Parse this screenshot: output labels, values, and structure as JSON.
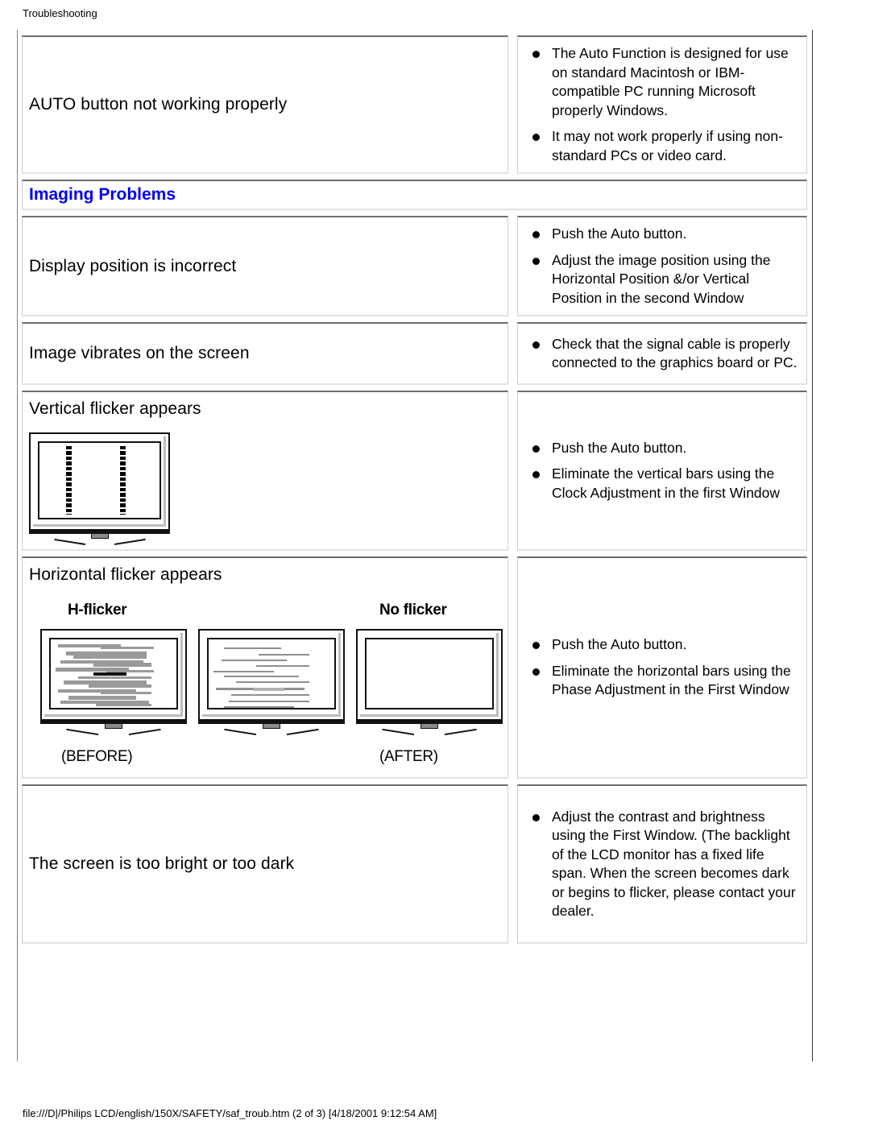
{
  "page": {
    "header": "Troubleshooting",
    "footer": "file:///D|/Philips LCD/english/150X/SAFETY/saf_troub.htm (2 of 3) [4/18/2001 9:12:54 AM]",
    "accent_color": "#0000ee",
    "text_color": "#000000",
    "background": "#ffffff"
  },
  "sections": [
    {
      "id": "imaging-problems",
      "label": "Imaging Problems"
    }
  ],
  "rows": [
    {
      "id": "auto-button",
      "problem": "AUTO button not working properly",
      "solutions": [
        "The Auto Function is designed for use on standard Macintosh or IBM-compatible PC running Microsoft properly Windows.",
        "It may not work properly if using non-standard PCs or video card."
      ]
    },
    {
      "id": "display-position",
      "problem": "Display position is incorrect",
      "solutions": [
        "Push the Auto button.",
        "Adjust the image position using the Horizontal Position &/or Vertical Position in the second Window"
      ]
    },
    {
      "id": "image-vibrates",
      "problem": "Image vibrates on the screen",
      "solutions": [
        "Check that the signal cable is properly connected to the graphics board or PC."
      ]
    },
    {
      "id": "vertical-flicker",
      "problem": "Vertical flicker appears",
      "solutions": [
        "Push the Auto button.",
        "Eliminate the vertical bars using the Clock Adjustment in the first Window"
      ]
    },
    {
      "id": "horizontal-flicker",
      "problem": "Horizontal flicker appears",
      "solutions": [
        "Push the Auto button.",
        "Eliminate the horizontal bars using the Phase Adjustment in the First Window"
      ]
    },
    {
      "id": "screen-brightness",
      "problem": "The screen is too bright or too dark",
      "solutions": [
        "Adjust the contrast and brightness using the First Window. (The backlight of the LCD monitor has a fixed life span. When the screen becomes dark or begins to flicker, please contact your dealer."
      ]
    }
  ],
  "illustrations": {
    "vertical_flicker": {
      "name": "vertical-flicker-monitor-illustration",
      "bars": 2
    },
    "horizontal_flicker": {
      "name": "horizontal-flicker-illustration",
      "label_left": "H-flicker",
      "label_right": "No flicker",
      "caption_left": "(BEFORE)",
      "caption_right": "(AFTER)",
      "monitors": 3
    }
  }
}
